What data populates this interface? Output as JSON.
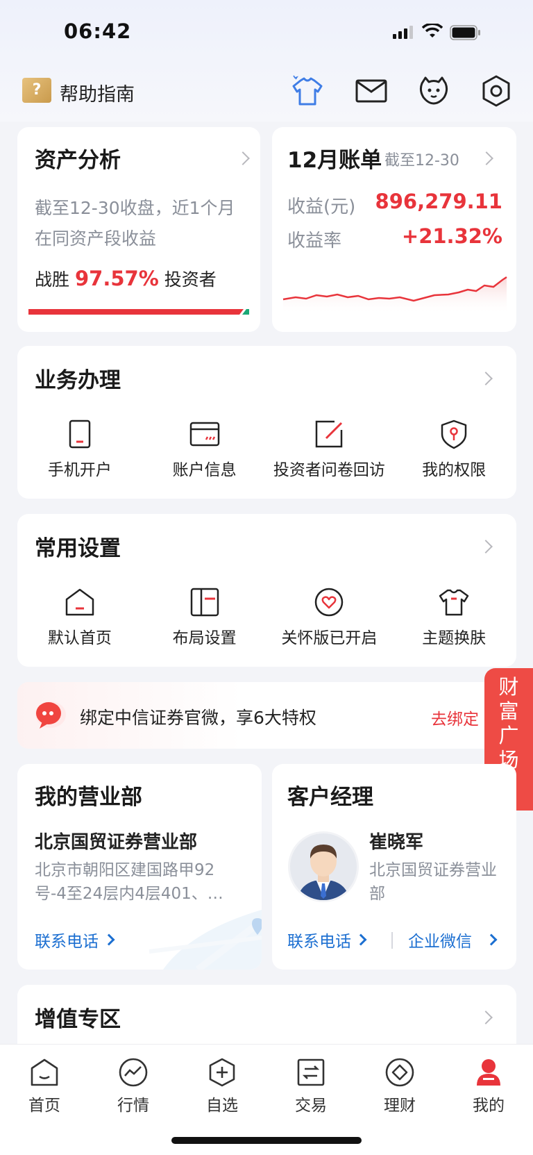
{
  "status_bar": {
    "time": "06:42"
  },
  "header": {
    "help_label": "帮助指南",
    "help_badge": "?"
  },
  "asset_analysis": {
    "title": "资产分析",
    "desc": "截至12-30收盘，近1个月在同资产段收益",
    "beat_prefix": "战胜",
    "beat_value": "97.57%",
    "beat_suffix": "投资者",
    "beat_ratio": 0.9757
  },
  "bill": {
    "title": "12月账单",
    "as_of": "截至12-30",
    "income_label": "收益(元)",
    "income_value": "896,279.11",
    "rate_label": "收益率",
    "rate_value": "+21.32%"
  },
  "business": {
    "title": "业务办理",
    "items": [
      {
        "label": "手机开户",
        "icon": "phone-icon"
      },
      {
        "label": "账户信息",
        "icon": "card-icon"
      },
      {
        "label": "投资者问卷回访",
        "icon": "edit-icon"
      },
      {
        "label": "我的权限",
        "icon": "shield-key-icon"
      }
    ]
  },
  "settings": {
    "title": "常用设置",
    "items": [
      {
        "label": "默认首页",
        "icon": "home-icon"
      },
      {
        "label": "布局设置",
        "icon": "layout-icon"
      },
      {
        "label": "关怀版已开启",
        "icon": "heart-icon"
      },
      {
        "label": "主题换肤",
        "icon": "shirt-icon"
      }
    ]
  },
  "banner": {
    "text": "绑定中信证券官微，享6大特权",
    "action": "去绑定"
  },
  "float_tab": {
    "chars": [
      "财",
      "富",
      "广",
      "场"
    ]
  },
  "branch": {
    "title": "我的营业部",
    "name": "北京国贸证券营业部",
    "address": "北京市朝阳区建国路甲92号-4至24层内4层401、…",
    "contact": "联系电话"
  },
  "manager": {
    "title": "客户经理",
    "name": "崔晓军",
    "dept": "北京国贸证券营业部",
    "contact": "联系电话",
    "wechat": "企业微信"
  },
  "value_added": {
    "title": "增值专区"
  },
  "tabbar": {
    "items": [
      {
        "label": "首页",
        "icon": "home-tab-icon"
      },
      {
        "label": "行情",
        "icon": "chart-tab-icon"
      },
      {
        "label": "自选",
        "icon": "add-tab-icon"
      },
      {
        "label": "交易",
        "icon": "trade-tab-icon"
      },
      {
        "label": "理财",
        "icon": "finance-tab-icon"
      },
      {
        "label": "我的",
        "icon": "person-tab-icon"
      }
    ],
    "active_index": 5
  },
  "colors": {
    "accent_red": "#e8343b",
    "link_blue": "#1c6fd1",
    "up_green": "#1aa876"
  }
}
